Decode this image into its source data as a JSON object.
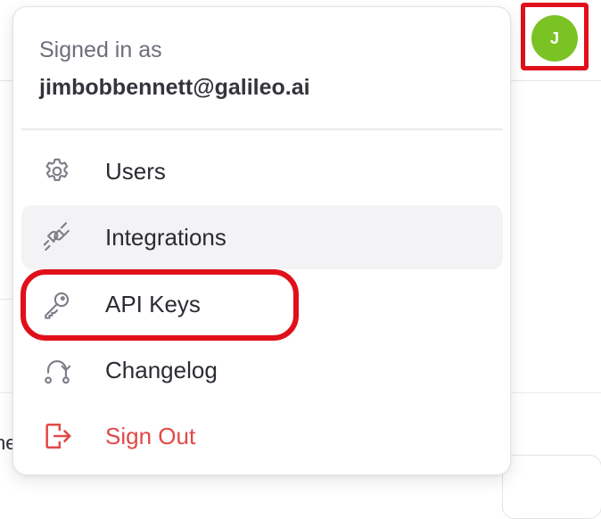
{
  "user": {
    "avatar_initial": "J"
  },
  "menu": {
    "signed_in_label": "Signed in as",
    "email": "jimbobbennett@galileo.ai",
    "items": [
      {
        "label": "Users",
        "icon": "gear-icon"
      },
      {
        "label": "Integrations",
        "icon": "plug-icon"
      },
      {
        "label": "API Keys",
        "icon": "key-icon"
      },
      {
        "label": "Changelog",
        "icon": "git-branch-icon"
      },
      {
        "label": "Sign Out",
        "icon": "sign-out-icon"
      }
    ]
  },
  "background": {
    "cut_text": "ne"
  },
  "colors": {
    "avatar": "#7bc324",
    "highlight": "#e0101a",
    "danger": "#e24848",
    "hover_bg": "#f3f3f6"
  }
}
